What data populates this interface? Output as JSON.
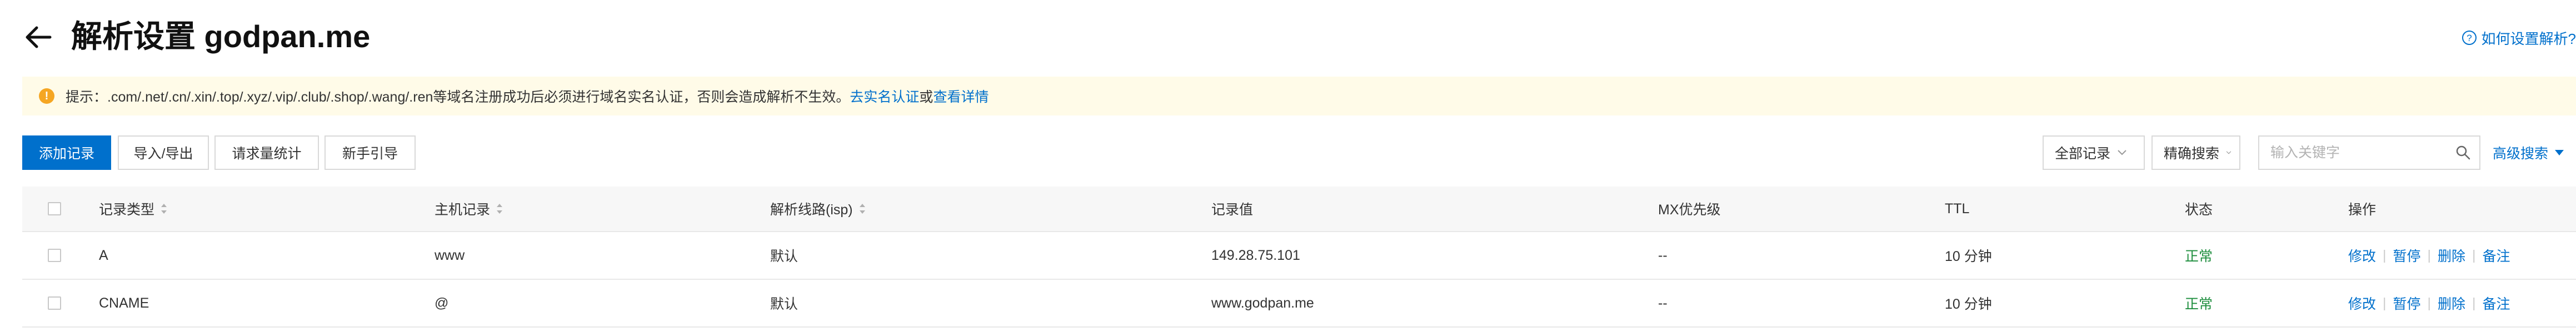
{
  "header": {
    "title": "解析设置 godpan.me",
    "help_link": "如何设置解析?"
  },
  "notice": {
    "text": "提示：.com/.net/.cn/.xin/.top/.xyz/.vip/.club/.shop/.wang/.ren等域名注册成功后必须进行域名实名认证，否则会造成解析不生效。",
    "link_verify": "去实名认证",
    "or": "或",
    "link_details": "查看详情"
  },
  "toolbar": {
    "add_record": "添加记录",
    "import_export": "导入/导出",
    "request_stats": "请求量统计",
    "guide": "新手引导",
    "filter_all": "全部记录",
    "search_mode": "精确搜索",
    "search_placeholder": "输入关键字",
    "advanced_search": "高级搜索"
  },
  "table": {
    "columns": {
      "type": "记录类型",
      "host": "主机记录",
      "line": "解析线路(isp)",
      "value": "记录值",
      "mx": "MX优先级",
      "ttl": "TTL",
      "status": "状态",
      "ops": "操作"
    },
    "rows": [
      {
        "type": "A",
        "host": "www",
        "line": "默认",
        "value": "149.28.75.101",
        "mx": "--",
        "ttl": "10 分钟",
        "status": "正常"
      },
      {
        "type": "CNAME",
        "host": "@",
        "line": "默认",
        "value": "www.godpan.me",
        "mx": "--",
        "ttl": "10 分钟",
        "status": "正常"
      }
    ],
    "actions": {
      "edit": "修改",
      "pause": "暂停",
      "delete": "删除",
      "note": "备注"
    }
  },
  "colors": {
    "primary": "#0070cc",
    "notice_bg": "#fffbe8",
    "warn": "#f5a623",
    "status_ok": "#1e8e3e"
  }
}
